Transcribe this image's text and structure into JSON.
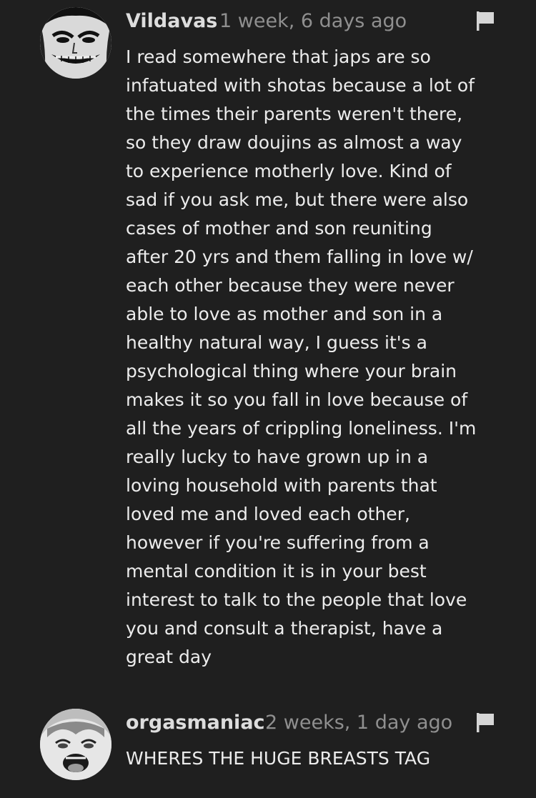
{
  "comments": [
    {
      "username": "Vildavas",
      "timestamp": "1 week, 6 days ago",
      "text": "I read somewhere that japs are so\ninfatuated with shotas because a lot of\nthe times their parents weren't there,\nso they draw doujins as almost a way\nto experience motherly love. Kind of\nsad if you ask me, but there were also\ncases of mother and son reuniting\nafter 20 yrs and them falling in love w/\neach other because they were never\nable to love as mother and son in a\nhealthy natural way, I guess it's a\npsychological thing where your brain\nmakes it so you fall in love because of\nall the years of crippling loneliness. I'm\nreally lucky to have grown up in a\nloving household with parents that\nloved me and loved each other,\nhowever if you're suffering from a\nmental condition it is in your best\ninterest to talk to the people that love\nyou and consult a therapist, have a\ngreat day",
      "avatar_icon": "avatar-grinning-face-icon",
      "flag_icon": "flag-icon"
    },
    {
      "username": "orgasmaniac",
      "timestamp": "2 weeks, 1 day ago",
      "text": "WHERES THE HUGE BREASTS TAG",
      "avatar_icon": "avatar-anime-face-icon",
      "flag_icon": "flag-icon"
    }
  ],
  "colors": {
    "background": "#1f1f1f",
    "username": "#dddddd",
    "timestamp": "#8f8f8f",
    "text": "#ececec"
  }
}
